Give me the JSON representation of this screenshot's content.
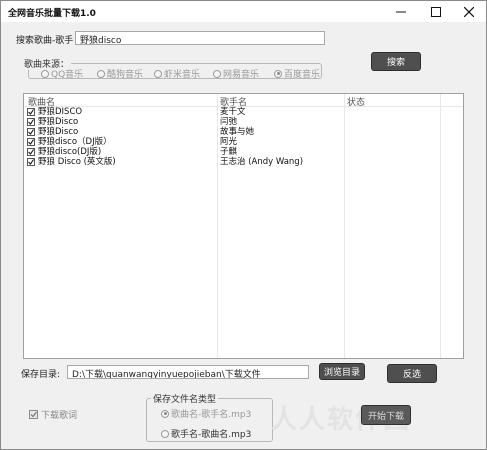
{
  "window": {
    "title": "全网音乐批量下载1.0"
  },
  "search": {
    "label": "搜索歌曲-歌手",
    "value": "野狼disco",
    "button": "搜索"
  },
  "source": {
    "legend": "歌曲来源：",
    "options": [
      {
        "label": "QQ音乐",
        "selected": false
      },
      {
        "label": "酷狗音乐",
        "selected": false
      },
      {
        "label": "虾米音乐",
        "selected": false
      },
      {
        "label": "网易音乐",
        "selected": false
      },
      {
        "label": "百度音乐",
        "selected": true
      }
    ]
  },
  "table": {
    "columns": [
      "歌曲名",
      "歌手名",
      "状态"
    ],
    "rows": [
      {
        "checked": true,
        "song": "野狼DISCO",
        "artist": "麦千文",
        "status": ""
      },
      {
        "checked": true,
        "song": "野狼Disco",
        "artist": "闫弛",
        "status": ""
      },
      {
        "checked": true,
        "song": "野狼Disco",
        "artist": "故事与她",
        "status": ""
      },
      {
        "checked": true,
        "song": "野狼disco（DJ版）",
        "artist": "阿光",
        "status": ""
      },
      {
        "checked": true,
        "song": "野狼disco(DJ版)",
        "artist": "子麒",
        "status": ""
      },
      {
        "checked": true,
        "song": "野狼 Disco (英文版)",
        "artist": "王志治 (Andy Wang)",
        "status": ""
      }
    ]
  },
  "save": {
    "label": "保存目录:",
    "path": "D:\\下载\\quanwangyinyuepojieban\\下载文件",
    "browse": "浏览目录",
    "invert": "反选"
  },
  "lyrics": {
    "label": "下载歌词",
    "checked": true
  },
  "naming": {
    "legend": "保存文件名类型",
    "options": [
      {
        "label": "歌曲名-歌手名.mp3",
        "selected": true
      },
      {
        "label": "歌手名-歌曲名.mp3",
        "selected": false
      }
    ]
  },
  "download": {
    "label": "开始下载"
  },
  "watermark": "人人软件园"
}
